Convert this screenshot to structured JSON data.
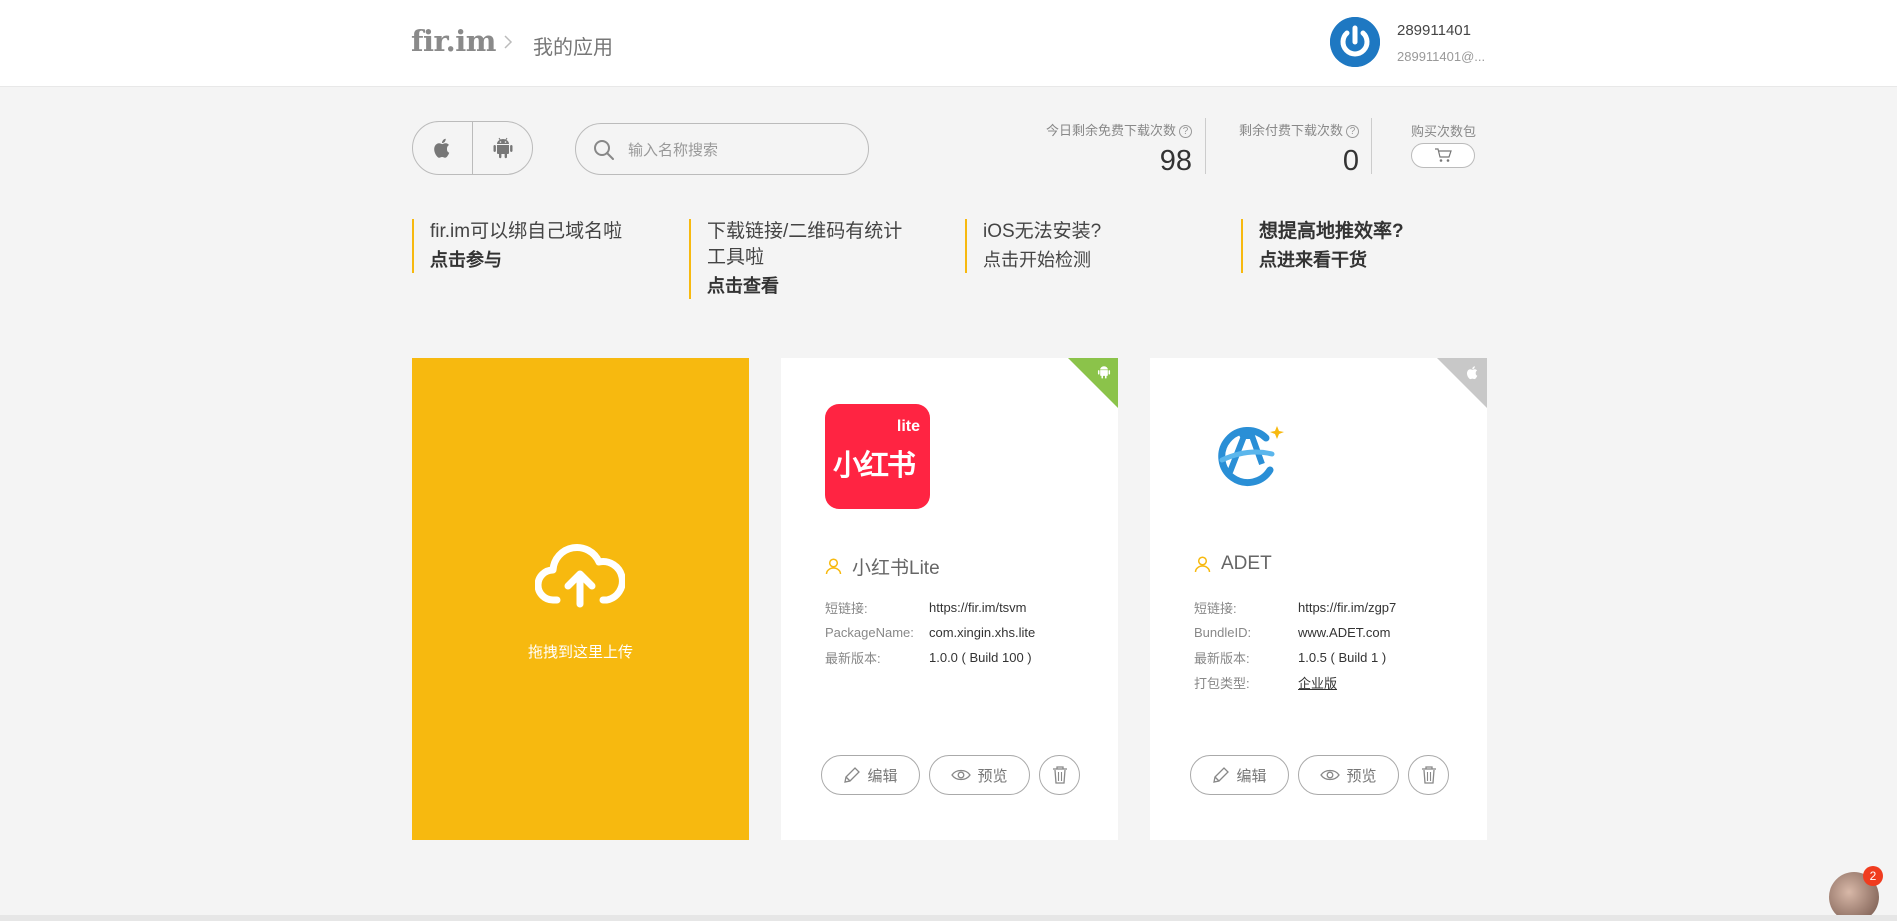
{
  "header": {
    "logo": "fir.im",
    "breadcrumb": "我的应用",
    "user": {
      "name": "289911401",
      "email": "289911401@..."
    }
  },
  "toolbar": {
    "search_placeholder": "输入名称搜索",
    "stats": {
      "free_label": "今日剩余免费下载次数",
      "free_value": "98",
      "paid_label": "剩余付费下载次数",
      "paid_value": "0",
      "buy_label": "购买次数包"
    }
  },
  "notices": [
    {
      "title": "fir.im可以绑自己域名啦",
      "link": "点击参与"
    },
    {
      "title": "下载链接/二维码有统计工具啦",
      "link": "点击查看"
    },
    {
      "title": "iOS无法安装?",
      "link": "点击开始检测"
    },
    {
      "title": "想提高地推效率?",
      "link": "点进来看干货"
    }
  ],
  "upload": {
    "label": "拖拽到这里上传"
  },
  "apps": [
    {
      "platform": "android",
      "corner_color": "#8bc34a",
      "name": "小红书Lite",
      "icon_text": "小红书",
      "icon_badge": "lite",
      "rows": [
        {
          "key": "短链接:",
          "value": "https://fir.im/tsvm"
        },
        {
          "key": "PackageName:",
          "value": "com.xingin.xhs.lite"
        },
        {
          "key": "最新版本:",
          "value": "1.0.0 ( Build 100 )"
        }
      ]
    },
    {
      "platform": "ios",
      "corner_color": "#c8c8c8",
      "name": "ADET",
      "rows": [
        {
          "key": "短链接:",
          "value": "https://fir.im/zgp7"
        },
        {
          "key": "BundleID:",
          "value": "www.ADET.com"
        },
        {
          "key": "最新版本:",
          "value": "1.0.5 ( Build 1 )"
        },
        {
          "key": "打包类型:",
          "value": "企业版"
        }
      ]
    }
  ],
  "buttons": {
    "edit": "编辑",
    "preview": "预览"
  },
  "chat": {
    "badge": "2"
  },
  "colors": {
    "accent": "#f7b90f",
    "brand_blue": "#1e78c2",
    "xhs_red": "#ff2442"
  }
}
